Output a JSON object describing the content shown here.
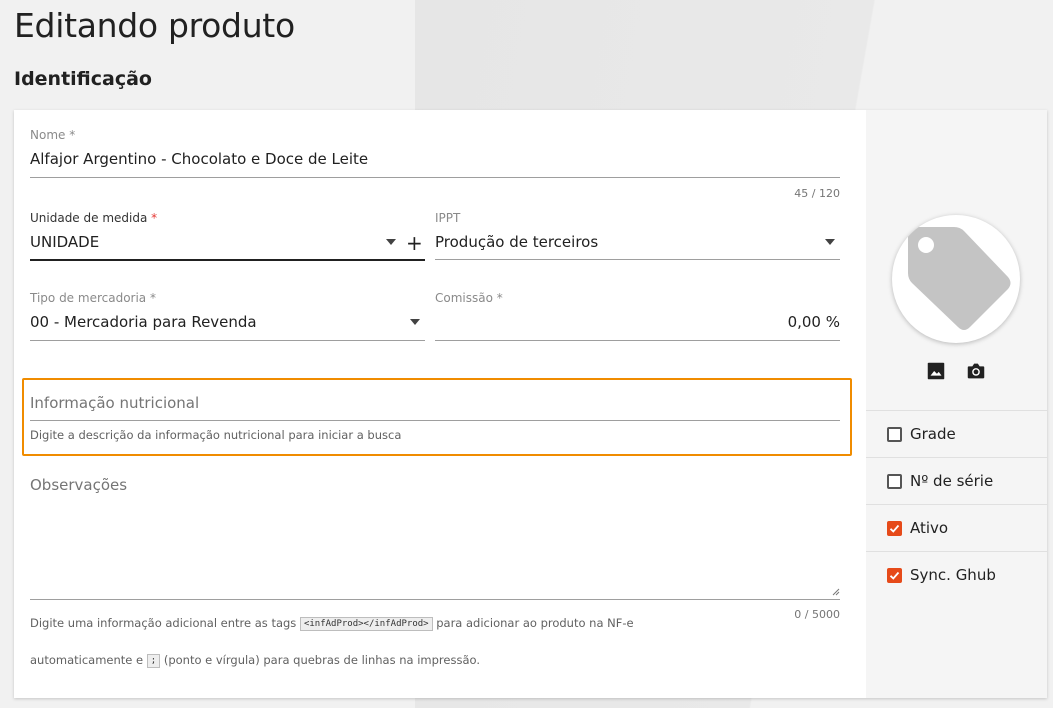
{
  "page": {
    "title": "Editando produto",
    "section": "Identificação"
  },
  "form": {
    "nome": {
      "label": "Nome",
      "required_mark": "*",
      "value": "Alfajor Argentino - Chocolato e Doce de Leite",
      "counter": "45 / 120"
    },
    "unidade": {
      "label": "Unidade de medida",
      "required_mark": "*",
      "value": "UNIDADE",
      "add": "+"
    },
    "ippt": {
      "label": "IPPT",
      "value": "Produção de terceiros"
    },
    "tipo": {
      "label": "Tipo de mercadoria",
      "required_mark": "*",
      "value": "00 - Mercadoria para Revenda"
    },
    "comissao": {
      "label": "Comissão",
      "required_mark": "*",
      "value": "0,00 %"
    },
    "nutricional": {
      "placeholder": "Informação nutricional",
      "hint": "Digite a descrição da informação nutricional para iniciar a busca"
    },
    "observacoes": {
      "placeholder": "Observações",
      "counter": "0 / 5000",
      "hint1_before": "Digite uma informação adicional entre as tags",
      "hint1_code": "<infAdProd></infAdProd>",
      "hint1_after": "para adicionar ao produto na NF-e",
      "hint2_before": "automaticamente e",
      "hint2_code": ";",
      "hint2_after": "(ponto e vírgula) para quebras de linhas na impressão."
    }
  },
  "sidebar": {
    "image_icons": [
      "tag-icon",
      "image-icon",
      "camera-icon"
    ],
    "options": [
      {
        "label": "Grade",
        "checked": false
      },
      {
        "label": "Nº de série",
        "checked": false
      },
      {
        "label": "Ativo",
        "checked": true
      },
      {
        "label": "Sync. Ghub",
        "checked": true
      }
    ]
  },
  "colors": {
    "accent": "#e64a19",
    "highlight": "#f08c00"
  }
}
